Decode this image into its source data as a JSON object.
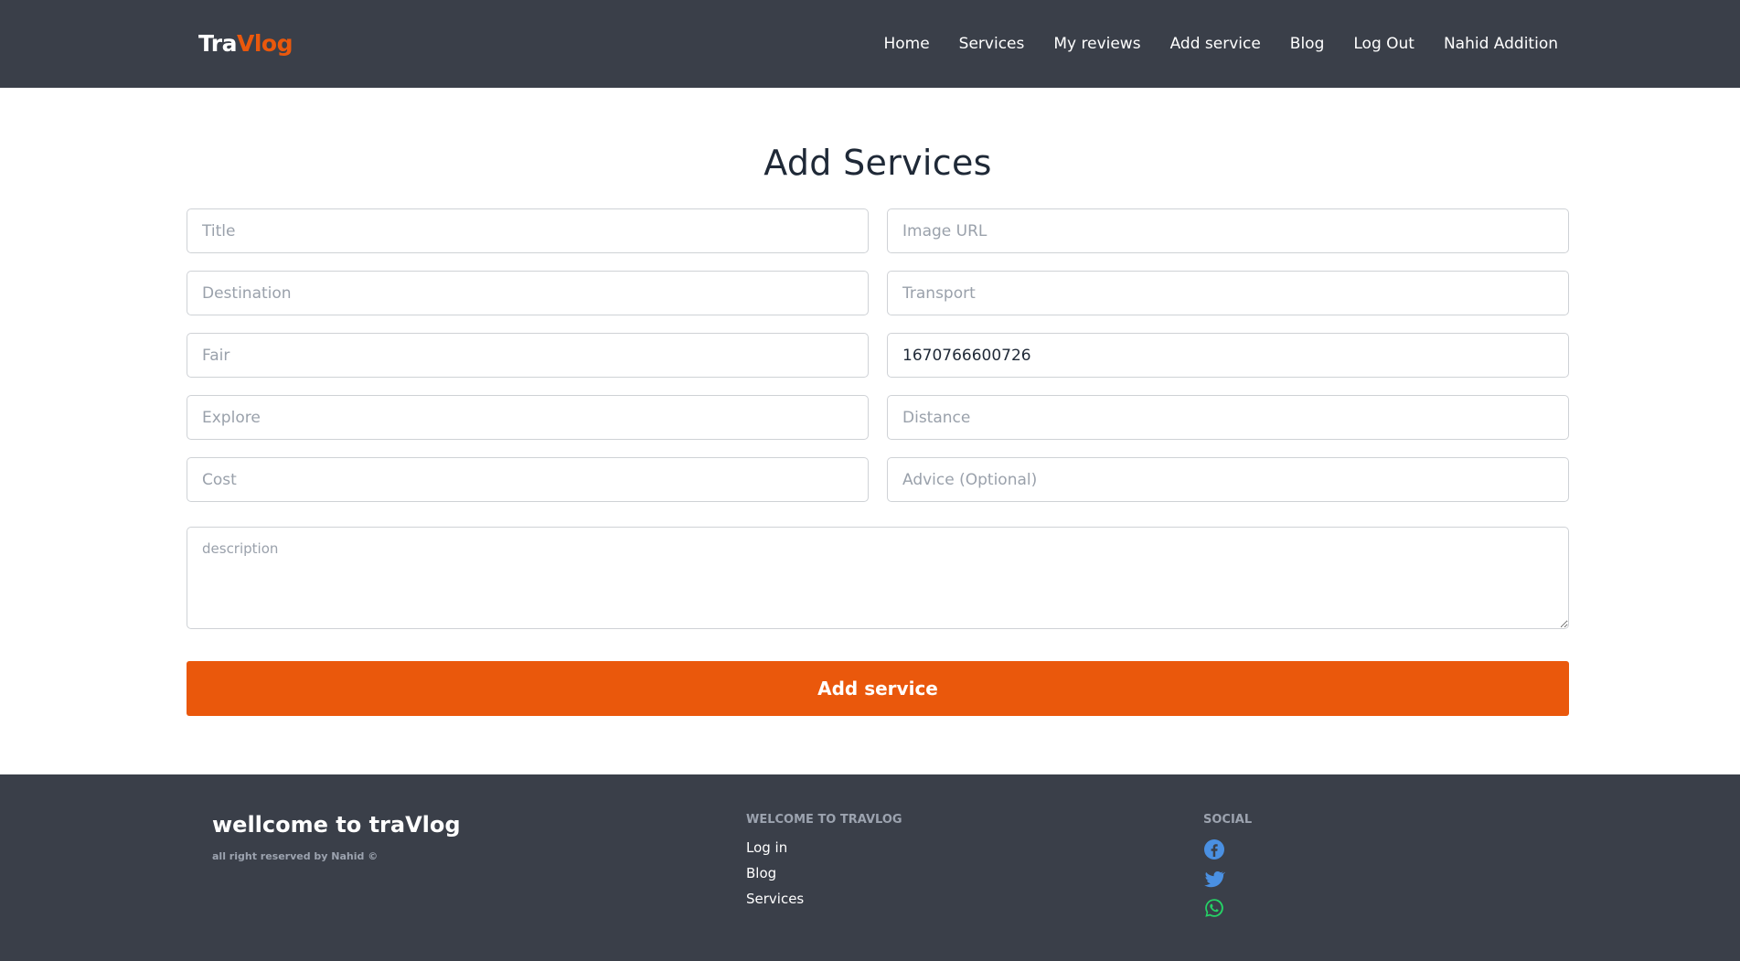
{
  "brand": {
    "part1": "Tra",
    "part2": "Vlog"
  },
  "nav": {
    "items": [
      {
        "label": "Home"
      },
      {
        "label": "Services"
      },
      {
        "label": "My reviews"
      },
      {
        "label": "Add service"
      },
      {
        "label": "Blog"
      },
      {
        "label": "Log Out"
      },
      {
        "label": "Nahid Addition"
      }
    ]
  },
  "form": {
    "title": "Add Services",
    "fields": {
      "title": {
        "placeholder": "Title",
        "value": ""
      },
      "image_url": {
        "placeholder": "Image URL",
        "value": ""
      },
      "destination": {
        "placeholder": "Destination",
        "value": ""
      },
      "transport": {
        "placeholder": "Transport",
        "value": ""
      },
      "fair": {
        "placeholder": "Fair",
        "value": ""
      },
      "time": {
        "placeholder": "",
        "value": "1670766600726"
      },
      "explore": {
        "placeholder": "Explore",
        "value": ""
      },
      "distance": {
        "placeholder": "Distance",
        "value": ""
      },
      "cost": {
        "placeholder": "Cost",
        "value": ""
      },
      "advice": {
        "placeholder": "Advice (Optional)",
        "value": ""
      },
      "description": {
        "placeholder": "description",
        "value": ""
      }
    },
    "submit_label": "Add service"
  },
  "footer": {
    "brand": "wellcome to traVlog",
    "rights": "all right reserved by Nahid ©",
    "links_heading": "Welcome to travlog",
    "links": [
      {
        "label": "Log in"
      },
      {
        "label": "Blog"
      },
      {
        "label": "Services"
      }
    ],
    "social_heading": "Social",
    "social_icons": [
      "facebook-icon",
      "twitter-icon",
      "whatsapp-icon"
    ]
  },
  "colors": {
    "accent": "#ea580c",
    "nav_bg": "#3a3f49",
    "facebook": "#4a90e2",
    "twitter": "#4a90e2",
    "whatsapp": "#25d366"
  }
}
